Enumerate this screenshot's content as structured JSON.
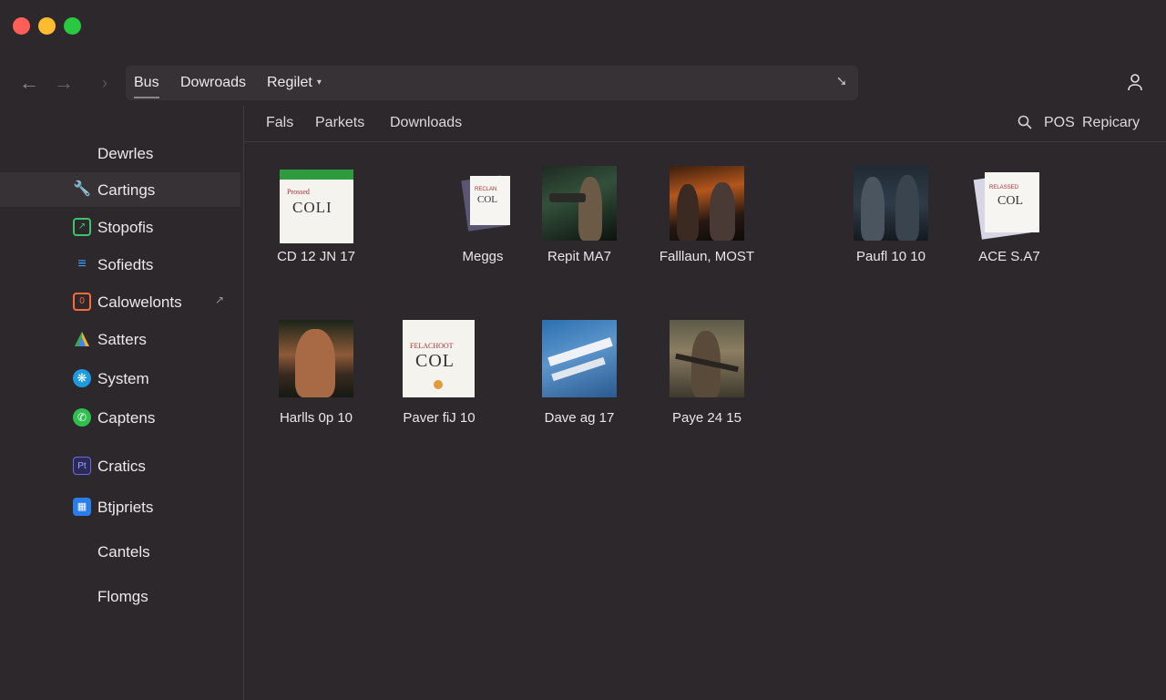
{
  "window": {
    "controls": [
      "close",
      "minimize",
      "zoom"
    ],
    "colors": {
      "close": "#ff5f57",
      "minimize": "#febc2e",
      "zoom": "#28c840"
    }
  },
  "toolbar": {
    "back_icon": "arrow-left-icon",
    "forward_icon": "arrow-right-icon",
    "up_icon": "chevron-right-icon",
    "tabs": [
      {
        "label": "Bus",
        "selected": true
      },
      {
        "label": "Dowroads"
      },
      {
        "label": "Regilet",
        "dropdown": true
      }
    ],
    "pin_icon": "pin-icon",
    "user_icon": "user-icon"
  },
  "sidebar": {
    "items": [
      {
        "label": "Dewrles",
        "icon": ""
      },
      {
        "label": "Cartings",
        "icon": "wrench-icon",
        "active": true
      },
      {
        "label": "Stopofis",
        "icon": "chart-icon"
      },
      {
        "label": "Sofiedts",
        "icon": "list-icon"
      },
      {
        "label": "Calowelonts",
        "icon": "calendar-icon"
      },
      {
        "label": "Satters",
        "icon": "triangle-icon"
      },
      {
        "label": "System",
        "icon": "atom-icon"
      },
      {
        "label": "Captens",
        "icon": "phone-icon"
      },
      {
        "label": "Cratics",
        "icon": "photoshop-icon"
      },
      {
        "label": "Btjpriets",
        "icon": "document-icon"
      },
      {
        "label": "Cantels",
        "icon": ""
      },
      {
        "label": "Flomgs",
        "icon": ""
      }
    ]
  },
  "content_header": {
    "tabs": [
      "Fals",
      "Parkets",
      "Downloads"
    ],
    "search_icon": "search-icon",
    "right": [
      "POS",
      "Repicary"
    ]
  },
  "items": [
    {
      "caption": "CD 12 JN 17",
      "thumb_text": [
        "Prossed",
        "COLI"
      ],
      "type": "document"
    },
    {
      "caption": "Meggs",
      "thumb_text": [
        "RECLAN",
        "COL"
      ],
      "type": "document-stack"
    },
    {
      "caption": "Repit MA7",
      "type": "game-art"
    },
    {
      "caption": "Falllaun, MOST",
      "type": "game-art"
    },
    {
      "caption": "Paufl 10 10",
      "type": "game-art"
    },
    {
      "caption": "ACE S.A7",
      "thumb_text": [
        "RELASSED",
        "COL"
      ],
      "type": "document-stack"
    },
    {
      "caption": "Harlls 0p 10",
      "type": "game-art"
    },
    {
      "caption": "Paver fiJ 10",
      "thumb_text": [
        "FELACHOOT",
        "COL"
      ],
      "type": "document"
    },
    {
      "caption": "Dave ag 17",
      "type": "game-art"
    },
    {
      "caption": "Paye 24 15",
      "type": "game-art"
    }
  ]
}
